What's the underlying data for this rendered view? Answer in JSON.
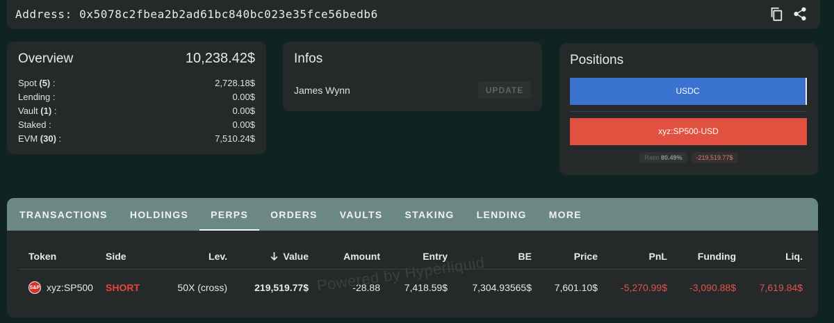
{
  "address": {
    "label": "Address:",
    "value": "0x5078c2fbea2b2ad61bc840bc023e35fce56bedb6"
  },
  "icons": {
    "copy": "copy-icon",
    "share": "share-icon"
  },
  "overview": {
    "title": "Overview",
    "total": "10,238.42$",
    "rows": [
      {
        "label": "Spot",
        "count": "(5)",
        "value": "2,728.18$"
      },
      {
        "label": "Lending",
        "count": "",
        "value": "0.00$"
      },
      {
        "label": "Vault",
        "count": "(1)",
        "value": "0.00$"
      },
      {
        "label": "Staked",
        "count": "",
        "value": "0.00$"
      },
      {
        "label": "EVM",
        "count": "(30)",
        "value": "7,510.24$"
      }
    ]
  },
  "infos": {
    "title": "Infos",
    "name": "James Wynn",
    "update_label": "UPDATE"
  },
  "positions": {
    "title": "Positions",
    "long_label": "USDC",
    "short_label": "xyz:SP500-USD",
    "ratio_label": "Ratio",
    "ratio_value": "80.49%",
    "pnl": "-219,519.77$"
  },
  "tabs": [
    {
      "label": "TRANSACTIONS",
      "active": false
    },
    {
      "label": "HOLDINGS",
      "active": false
    },
    {
      "label": "PERPS",
      "active": true
    },
    {
      "label": "ORDERS",
      "active": false
    },
    {
      "label": "VAULTS",
      "active": false
    },
    {
      "label": "STAKING",
      "active": false
    },
    {
      "label": "LENDING",
      "active": false
    },
    {
      "label": "MORE",
      "active": false
    }
  ],
  "table": {
    "headers": {
      "token": "Token",
      "side": "Side",
      "lev": "Lev.",
      "value": "Value",
      "amount": "Amount",
      "entry": "Entry",
      "be": "BE",
      "price": "Price",
      "pnl": "PnL",
      "funding": "Funding",
      "liq": "Liq."
    },
    "rows": [
      {
        "token_icon_text": "S&P",
        "token": "xyz:SP500",
        "side": "SHORT",
        "lev": "50X (cross)",
        "value": "219,519.77$",
        "amount": "-28.88",
        "entry": "7,418.59$",
        "be": "7,304.93565$",
        "price": "7,601.10$",
        "pnl": "-5,270.99$",
        "funding": "-3,090.88$",
        "liq": "7,619.84$"
      }
    ]
  },
  "watermark": "Powered by Hyperliquid",
  "colors": {
    "background": "#0f2420",
    "card": "#25292a",
    "tabbar": "#6b8882",
    "long": "#3a72cf",
    "short": "#e2503f",
    "negative": "#e0554b"
  }
}
